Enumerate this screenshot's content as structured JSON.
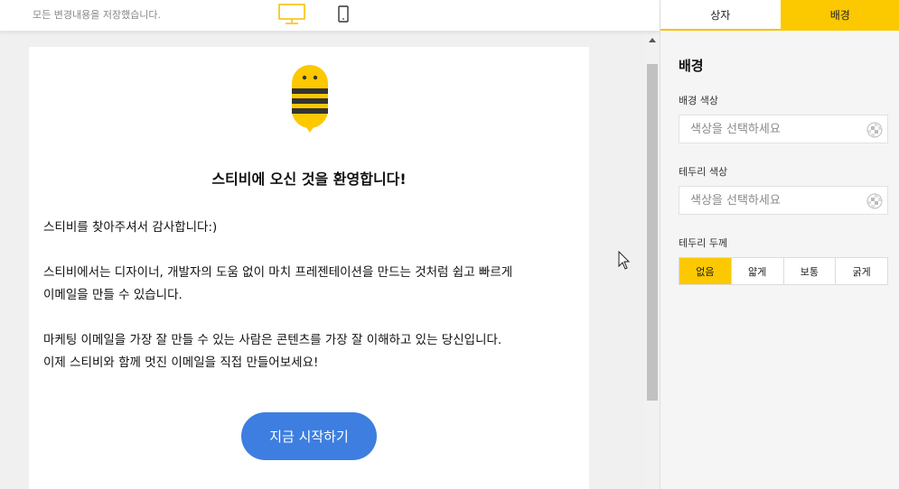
{
  "topbar": {
    "save_status": "모든 변경내용을 저장했습니다.",
    "desktop_icon": "desktop-monitor-icon",
    "mobile_icon": "mobile-phone-icon",
    "accent_color": "#f7c10a"
  },
  "email": {
    "logo_icon": "stibee-bee-logo",
    "title": "스티비에 오신 것을 환영합니다!",
    "paragraph1": "스티비를 찾아주셔서 감사합니다:)",
    "paragraph2_line1": "스티비에서는 디자이너, 개발자의 도움 없이 마치 프레젠테이션을 만드는 것처럼 쉽고 빠르게",
    "paragraph2_line2": "이메일을 만들 수 있습니다.",
    "paragraph3_line1": "마케팅 이메일을 가장 잘 만들 수 있는 사람은 콘텐츠를 가장 잘 이해하고 있는 당신입니다.",
    "paragraph3_line2": "이제 스티비와 함께 멋진 이메일을 직접 만들어보세요!",
    "cta_label": "지금 시작하기",
    "cta_color": "#3d7ee0"
  },
  "panel": {
    "tabs": [
      {
        "label": "상자",
        "active": false
      },
      {
        "label": "배경",
        "active": true
      }
    ],
    "heading": "배경",
    "background_color": {
      "label": "배경 색상",
      "placeholder": "색상을 선택하세요",
      "icon": "color-palette-icon"
    },
    "border_color": {
      "label": "테두리 색상",
      "placeholder": "색상을 선택하세요",
      "icon": "color-palette-icon"
    },
    "border_thickness": {
      "label": "테두리 두께",
      "options": [
        "없음",
        "얇게",
        "보통",
        "굵게"
      ],
      "selected": "없음"
    },
    "accent_color": "#fcc800"
  }
}
